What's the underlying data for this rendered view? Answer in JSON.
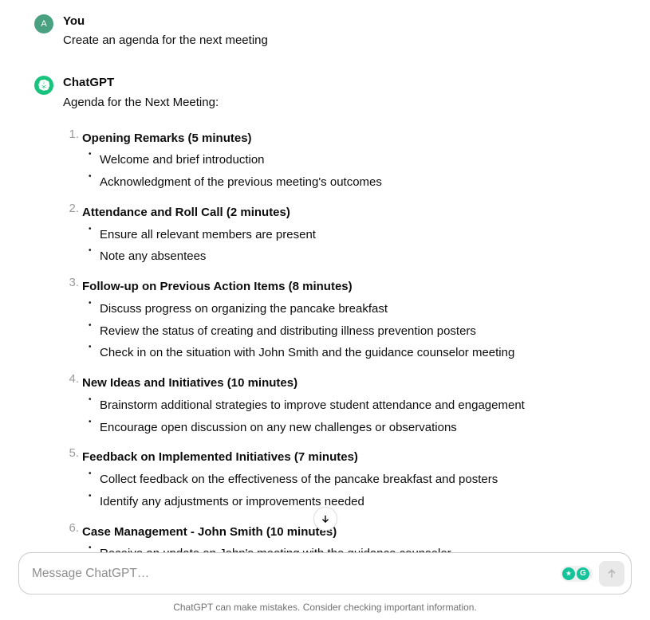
{
  "messages": {
    "user": {
      "sender": "You",
      "avatar_letter": "A",
      "text": "Create an agenda for the next meeting"
    },
    "assistant": {
      "sender": "ChatGPT",
      "intro": "Agenda for the Next Meeting:",
      "agenda": [
        {
          "title": "Opening Remarks (5 minutes)",
          "items": [
            "Welcome and brief introduction",
            "Acknowledgment of the previous meeting's outcomes"
          ]
        },
        {
          "title": "Attendance and Roll Call (2 minutes)",
          "items": [
            "Ensure all relevant members are present",
            "Note any absentees"
          ]
        },
        {
          "title": "Follow-up on Previous Action Items (8 minutes)",
          "items": [
            "Discuss progress on organizing the pancake breakfast",
            "Review the status of creating and distributing illness prevention posters",
            "Check in on the situation with John Smith and the guidance counselor meeting"
          ]
        },
        {
          "title": "New Ideas and Initiatives (10 minutes)",
          "items": [
            "Brainstorm additional strategies to improve student attendance and engagement",
            "Encourage open discussion on any new challenges or observations"
          ]
        },
        {
          "title": "Feedback on Implemented Initiatives (7 minutes)",
          "items": [
            "Collect feedback on the effectiveness of the pancake breakfast and posters",
            "Identify any adjustments or improvements needed"
          ]
        },
        {
          "title": "Case Management - John Smith (10 minutes)",
          "items": [
            "Receive an update on John's meeting with the guidance counselor"
          ]
        }
      ]
    }
  },
  "input": {
    "placeholder": "Message ChatGPT…"
  },
  "footer": "ChatGPT can make mistakes. Consider checking important information."
}
